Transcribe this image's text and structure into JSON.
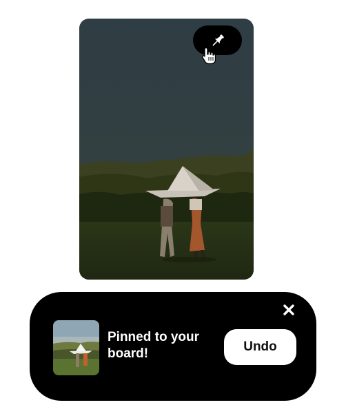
{
  "pin": {
    "image_icon": "paper-boat-photo",
    "pin_button_icon": "pushpin-icon",
    "cursor_icon": "hand-pointer-icon"
  },
  "toast": {
    "message": "Pinned to your board!",
    "undo_label": "Undo",
    "close_icon": "close-icon",
    "background": "#000000"
  }
}
